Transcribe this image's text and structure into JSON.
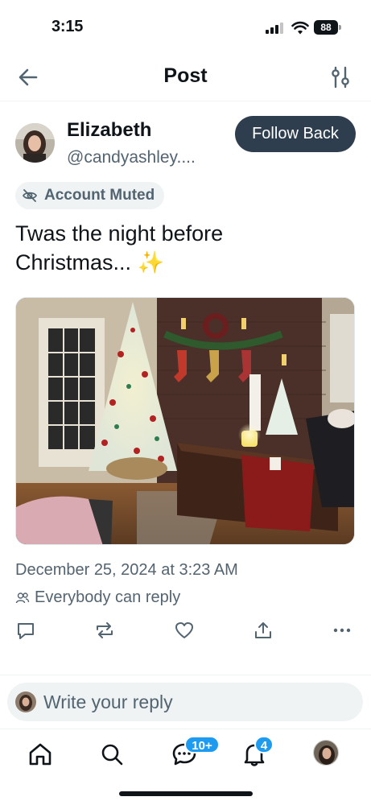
{
  "status_bar": {
    "time": "3:15",
    "battery": "88"
  },
  "nav": {
    "title": "Post",
    "back_icon": "back-arrow-icon",
    "settings_icon": "sliders-icon"
  },
  "author": {
    "name": "Elizabeth",
    "handle": "@candyashley....",
    "follow_label": "Follow Back"
  },
  "muted_chip": {
    "label": "Account Muted",
    "icon": "eye-slash-icon"
  },
  "post": {
    "text_line1": "Twas the night before",
    "text_line2": "Christmas...",
    "emoji": "✨",
    "image_alt": "Christmas living room",
    "date": "December 25, 2024 at 3:23 AM",
    "reply_permission": "Everybody can reply"
  },
  "actions": [
    "reply-icon",
    "repost-icon",
    "like-icon",
    "share-icon",
    "more-icon"
  ],
  "reply_bar": {
    "placeholder": "Write your reply"
  },
  "tabbar": {
    "items": [
      "home-icon",
      "search-icon",
      "messages-icon",
      "notifications-icon",
      "profile-avatar"
    ],
    "messages_badge": "10+",
    "notifications_badge": "4"
  },
  "colors": {
    "accent": "#1d9bf0",
    "follow_button": "#2f3e4e",
    "muted_text": "#536471"
  }
}
